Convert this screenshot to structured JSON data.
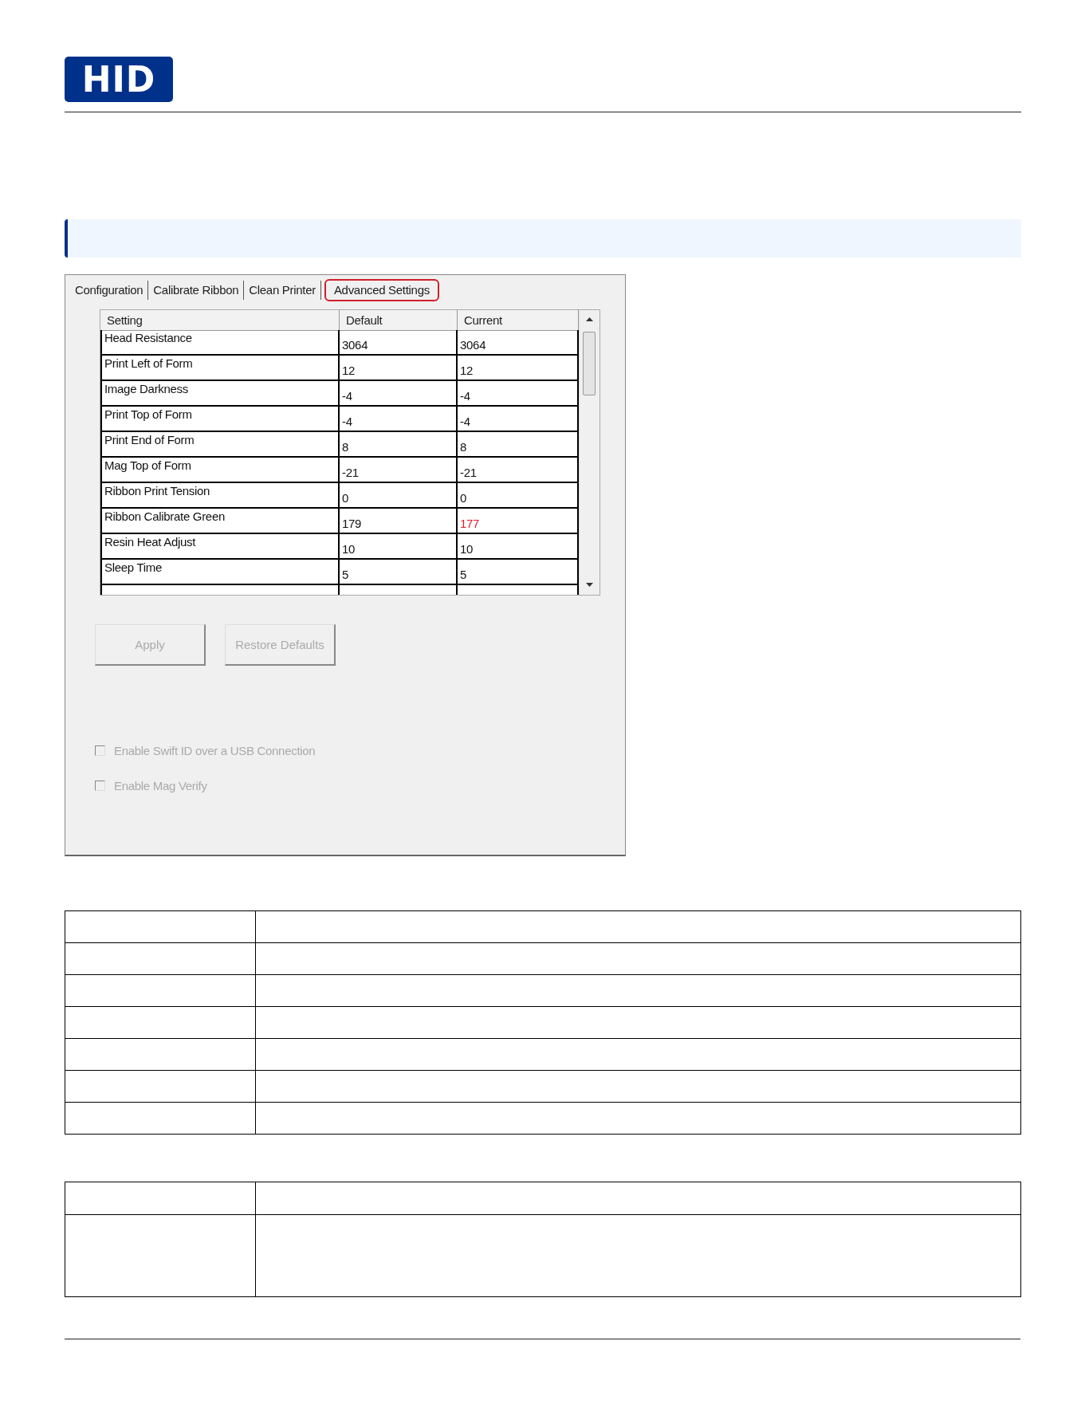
{
  "logo": {
    "text": "HID"
  },
  "dialog": {
    "tabs": [
      {
        "label": "Configuration",
        "selected": false
      },
      {
        "label": "Calibrate Ribbon",
        "selected": false
      },
      {
        "label": "Clean Printer",
        "selected": false
      },
      {
        "label": "Advanced Settings",
        "selected": true
      }
    ],
    "grid": {
      "columns": [
        "Setting",
        "Default",
        "Current"
      ],
      "rows": [
        {
          "setting": "Head Resistance",
          "default": "3064",
          "current": "3064",
          "changed": false
        },
        {
          "setting": "Print Left of Form",
          "default": "12",
          "current": "12",
          "changed": false
        },
        {
          "setting": "Image Darkness",
          "default": "-4",
          "current": "-4",
          "changed": false
        },
        {
          "setting": "Print Top of Form",
          "default": "-4",
          "current": "-4",
          "changed": false
        },
        {
          "setting": "Print End of Form",
          "default": "8",
          "current": "8",
          "changed": false
        },
        {
          "setting": "Mag Top of Form",
          "default": "-21",
          "current": "-21",
          "changed": false
        },
        {
          "setting": "Ribbon Print Tension",
          "default": "0",
          "current": "0",
          "changed": false
        },
        {
          "setting": "Ribbon Calibrate Green",
          "default": "179",
          "current": "177",
          "changed": true
        },
        {
          "setting": "Resin Heat Adjust",
          "default": "10",
          "current": "10",
          "changed": false
        },
        {
          "setting": "Sleep Time",
          "default": "5",
          "current": "5",
          "changed": false
        }
      ]
    },
    "buttons": [
      {
        "label": "Apply",
        "disabled": true
      },
      {
        "label": "Restore Defaults",
        "disabled": true
      }
    ],
    "checkboxes": [
      {
        "label": "Enable Swift ID over a USB Connection",
        "checked": false,
        "disabled": true
      },
      {
        "label": "Enable Mag Verify",
        "checked": false,
        "disabled": true
      }
    ]
  }
}
